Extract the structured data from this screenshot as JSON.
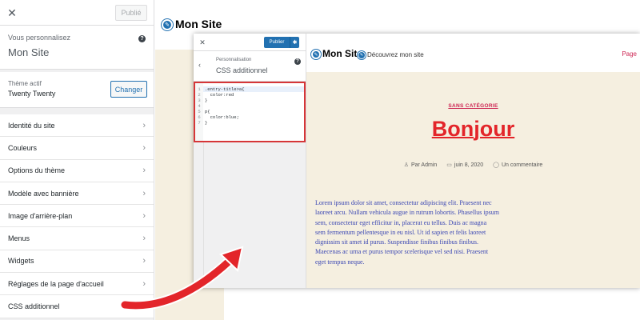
{
  "back_customizer": {
    "close_icon": "close-icon",
    "publish_label": "Publié",
    "info_sub": "Vous personnalisez",
    "info_title": "Mon Site",
    "help_icon": "help-icon",
    "theme_sub": "Thème actif",
    "theme_name": "Twenty Twenty",
    "change_label": "Changer",
    "menu": [
      {
        "label": "Identité du site"
      },
      {
        "label": "Couleurs"
      },
      {
        "label": "Options du thème"
      },
      {
        "label": "Modèle avec bannière"
      },
      {
        "label": "Image d'arrière-plan"
      },
      {
        "label": "Menus"
      },
      {
        "label": "Widgets"
      },
      {
        "label": "Réglages de la page d'accueil"
      },
      {
        "label": "CSS additionnel"
      }
    ],
    "chevron": "›"
  },
  "back_preview": {
    "site_title": "Mon Site"
  },
  "front_customizer": {
    "publish_label": "Publier",
    "gear_icon": "gear-icon",
    "back_icon": "chevron-left-icon",
    "section_sub": "Personnalisation",
    "section_title": "CSS additionnel",
    "code_lines": [
      {
        "num": "1",
        "text": ".entry-title>a{"
      },
      {
        "num": "2",
        "text": "  color:red"
      },
      {
        "num": "3",
        "text": "}"
      },
      {
        "num": "4",
        "text": ""
      },
      {
        "num": "5",
        "text": "p{"
      },
      {
        "num": "6",
        "text": "  color:blue;"
      },
      {
        "num": "7",
        "text": "}"
      }
    ]
  },
  "front_preview": {
    "site_title": "Mon Site",
    "tagline": "Découvrez mon site",
    "page_link": "Page",
    "category": "SANS CATÉGORIE",
    "post_title": "Bonjour",
    "meta_author": "Par Admin",
    "meta_date": "juin 8, 2020",
    "meta_comments": "Un commentaire",
    "body_lines": [
      "Lorem ipsum dolor sit amet, consectetur adipiscing elit. Praesent nec",
      "laoreet arcu. Nullam vehicula augue in rutrum lobortis. Phasellus ipsum",
      "sem, consectetur eget efficitur in, placerat eu tellus. Duis ac magna",
      "sem fermentum pellentesque in eu nisl. Ut id sapien et felis laoreet",
      "dignissim sit amet id purus. Suspendisse finibus finibus finibus.",
      "Maecenas ac urna et purus tempor scelerisque vel sed nisi. Praesent",
      "eget tempus neque."
    ]
  },
  "colors": {
    "wp_blue": "#2271b1",
    "accent_red": "#e3252a",
    "link_pink": "#cd2653",
    "body_blue": "#3b47b3",
    "highlight_border": "#d63638"
  }
}
